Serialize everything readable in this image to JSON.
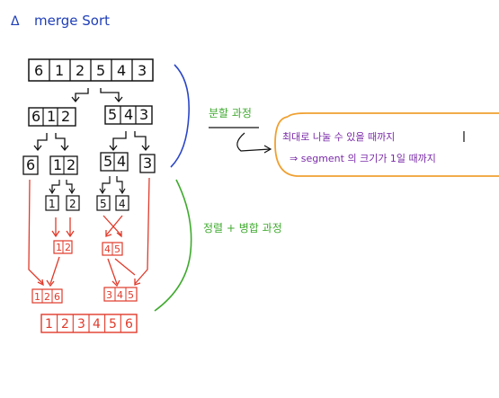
{
  "title": "merge Sort",
  "title_marker": "Δ",
  "colors": {
    "ink": "#111111",
    "title_blue": "#1f3fb8",
    "bracket_blue": "#2a46c8",
    "bracket_green": "#3faa2e",
    "note_purple": "#7a2aa8",
    "note_orange": "#f0a030",
    "merge_red": "#e03a2a"
  },
  "divide_label": "분할 과정",
  "merge_label": "정렬 + 병합 과정",
  "note": {
    "line1": "최대로 나눌 수 있을 때까지",
    "line2": "⇒ segment 의 크기가 1일 때까지"
  },
  "levels": {
    "root": [
      "6",
      "1",
      "2",
      "5",
      "4",
      "3"
    ],
    "split1_left": [
      "6",
      "1",
      "2"
    ],
    "split1_right": [
      "5",
      "4",
      "3"
    ],
    "split2": [
      [
        "6"
      ],
      [
        "1",
        "2"
      ],
      [
        "5",
        "4"
      ],
      [
        "3"
      ]
    ],
    "split3": [
      [
        "1"
      ],
      [
        "2"
      ],
      [
        "5"
      ],
      [
        "4"
      ]
    ],
    "merge1": [
      [
        "1",
        "2"
      ],
      [
        "4",
        "5"
      ]
    ],
    "merge2": [
      [
        "1",
        "2",
        "6"
      ],
      [
        "3",
        "4",
        "5"
      ]
    ],
    "result": [
      "1",
      "2",
      "3",
      "4",
      "5",
      "6"
    ]
  }
}
